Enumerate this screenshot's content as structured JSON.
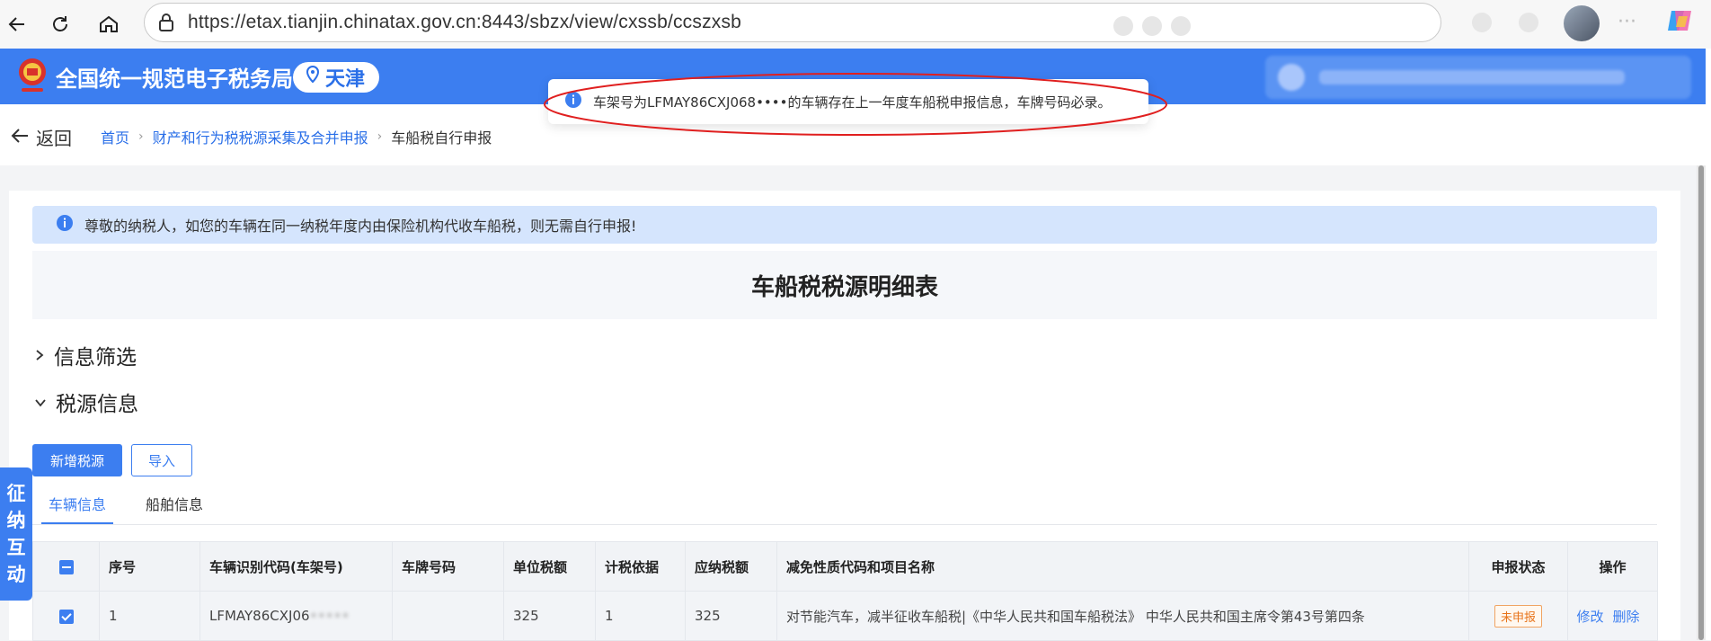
{
  "browser": {
    "url": "https://etax.tianjin.chinatax.gov.cn:8443/sbzx/view/cxssb/ccszxsb"
  },
  "header": {
    "site_name": "全国统一规范电子税务局",
    "region": "天津",
    "brand_color": "#3c7ef0"
  },
  "toast": {
    "message": "车架号为LFMAY86CXJ068••••的车辆存在上一年度车船税申报信息，车牌号码必录。",
    "icon": "info-icon"
  },
  "nav": {
    "back_label": "返回",
    "breadcrumbs": [
      "首页",
      "财产和行为税税源采集及合并申报",
      "车船税自行申报"
    ]
  },
  "notice": {
    "text": "尊敬的纳税人，如您的车辆在同一纳税年度内由保险机构代收车船税，则无需自行申报!"
  },
  "page": {
    "title": "车船税税源明细表",
    "section_filter": "信息筛选",
    "section_source": "税源信息",
    "btn_add": "新增税源",
    "btn_import": "导入",
    "tabs": [
      "车辆信息",
      "船舶信息"
    ]
  },
  "table": {
    "headers": [
      "序号",
      "车辆识别代码(车架号)",
      "车牌号码",
      "单位税额",
      "计税依据",
      "应纳税额",
      "减免性质代码和项目名称",
      "申报状态",
      "操作"
    ],
    "rows": [
      {
        "index": "1",
        "vin_visible": "LFMAY86CXJ06",
        "vin_hidden": "•••••",
        "plate": "",
        "unit_tax": "325",
        "basis": "1",
        "tax_due": "325",
        "relief": "对节能汽车，减半征收车船税|《中华人民共和国车船税法》 中华人民共和国主席令第43号第四条",
        "status": "未申报",
        "action_edit": "修改",
        "action_delete": "删除"
      }
    ]
  },
  "sidetab": {
    "chars": [
      "征",
      "纳",
      "互",
      "动"
    ]
  }
}
